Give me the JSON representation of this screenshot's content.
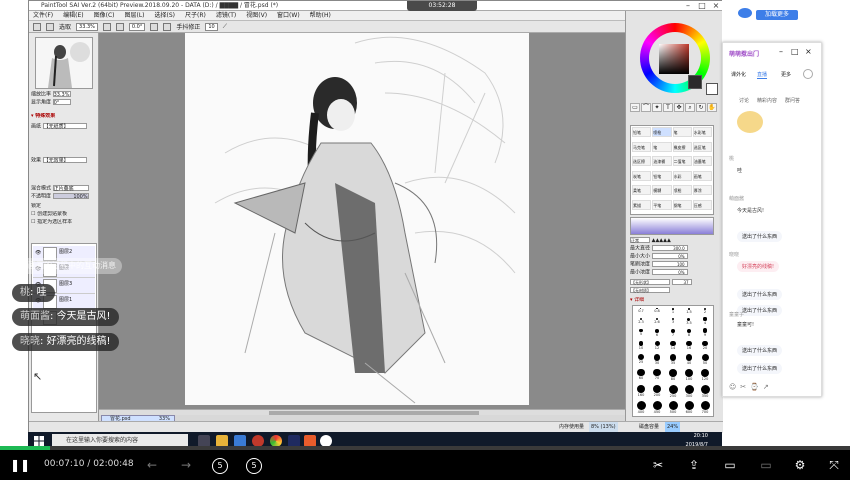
{
  "sai": {
    "title": "PaintTool SAI Ver.2 (64bit) Preview.2018.09.20 - DATA (D:) / ▇▇▇▇ / 冒花.psd (*)",
    "recording_time": "03:52:28",
    "menu": [
      "文件(F)",
      "编辑(E)",
      "图像(C)",
      "图层(L)",
      "选择(S)",
      "尺子(R)",
      "滤镜(T)",
      "视图(V)",
      "窗口(W)",
      "帮助(H)"
    ],
    "toolbar": {
      "select_label": "选取",
      "zoom": "33.3%",
      "angle": "0.0°",
      "stabilizer_label": "手抖修正",
      "stabilizer_value": "10"
    },
    "left_panel": {
      "zoom_label": "缩放比率",
      "zoom_value": "33.3%",
      "angle_label": "显示角度",
      "angle_value": "0°",
      "section_header": "▾ 特殊效果",
      "texture_label": "画纸",
      "texture_value": "【无纸质】",
      "effect_label": "效果",
      "effect_value": "【无效果】",
      "blend_label": "混合模式",
      "blend_value": "正片叠底",
      "opacity_label": "不透明度",
      "opacity_value": "100%",
      "lock_label": "锁定",
      "clip_label": "创建剪贴蒙板",
      "ref_label": "指定为选区样本",
      "layers": [
        {
          "name": "图层2",
          "mode": "正常",
          "opacity": "100%"
        },
        {
          "name": "图层",
          "mode": "正常",
          "opacity": "100%"
        },
        {
          "name": "图层3",
          "mode": "正常",
          "opacity": "100%"
        },
        {
          "name": "图层1",
          "mode": "正常",
          "opacity": "100%"
        },
        {
          "name": "背景",
          "mode": "正常",
          "opacity": "100%"
        }
      ]
    },
    "doc_tab": {
      "name": "冒花.psd",
      "zoom": "33%"
    },
    "status": {
      "memory_label": "内存使用量",
      "memory_value": "8% (13%)",
      "disk_label": "磁盘容量",
      "disk_value": "24%"
    },
    "right_panel": {
      "brushes": [
        "铅笔",
        "喷枪",
        "笔",
        "水彩笔",
        "马克笔",
        "笔",
        "橡皮擦",
        "选区笔",
        "选区擦",
        "油漆桶",
        "二值笔",
        "油墨笔",
        "炭笔",
        "铅笔",
        "水彩",
        "画笔",
        "柔笔",
        "模糊",
        "喷枪",
        "厚涂",
        "素描",
        "平笔",
        "钢笔",
        "压感"
      ],
      "mode_label": "正常",
      "size_label": "最大直径",
      "size_value": "300.0",
      "min_size_label": "最小大小",
      "min_size_value": "0%",
      "density_label": "笔刷浓度",
      "density_value": "100",
      "min_density_label": "最小浓度",
      "min_density_value": "0%",
      "shape_label": "【无形状】",
      "texture_label": "【无材质】",
      "shape_value": "37",
      "detail_label": "▾ 详细",
      "sizes": [
        "0.7",
        "0.8",
        "1",
        "1.5",
        "2",
        "2.3",
        "2.6",
        "3",
        "3.5",
        "4",
        "5",
        "6",
        "7",
        "8",
        "9",
        "10",
        "12",
        "14",
        "16",
        "20",
        "25",
        "30",
        "35",
        "40",
        "50",
        "60",
        "70",
        "80",
        "100",
        "120",
        "160",
        "200",
        "250",
        "300",
        "350",
        "400",
        "450",
        "500",
        "600",
        "700"
      ]
    }
  },
  "taskbar": {
    "search_placeholder": "在这里输入你要搜索的内容",
    "time": "20:10",
    "date": "2019/8/7"
  },
  "topright": {
    "follow_button": "加载更多"
  },
  "chat_window": {
    "title": "萌萌惹出门",
    "tabs": [
      "课外化",
      "直播",
      "更多"
    ],
    "sub_tabs": [
      "讨论",
      "精彩内容",
      "群问答"
    ],
    "messages": [
      {
        "user": "桃",
        "text": "哇"
      },
      {
        "user": "萌面酱",
        "text": "今天是古风!"
      },
      {
        "user": "老师",
        "text": "送出了什么东西"
      },
      {
        "user": "晓晓",
        "text": "好漂亮的线稿!"
      },
      {
        "user": "老师",
        "text": "送出了什么东西"
      },
      {
        "user": "老师",
        "text": "送出了什么东西"
      },
      {
        "user": "童童子",
        "text": "童童可!"
      },
      {
        "user": "老师",
        "text": "送出了什么东西"
      },
      {
        "user": "老师",
        "text": "送出了什么东西"
      }
    ]
  },
  "overlay": {
    "ghost_text": "在画画的过程中的互动消息",
    "comments": [
      {
        "nick": "桃",
        "text": "哇"
      },
      {
        "nick": "萌面酱",
        "text": "今天是古风!"
      },
      {
        "nick": "晓晓",
        "text": "好漂亮的线稿!"
      }
    ]
  },
  "player": {
    "current_time": "00:07:10",
    "total_time": "02:00:48",
    "progress": 0.059,
    "skip_back": "5",
    "skip_forward": "5"
  },
  "colors": {
    "accent_green": "#1db954",
    "taskbar": "#101a2a",
    "player_bg": "#000000"
  }
}
